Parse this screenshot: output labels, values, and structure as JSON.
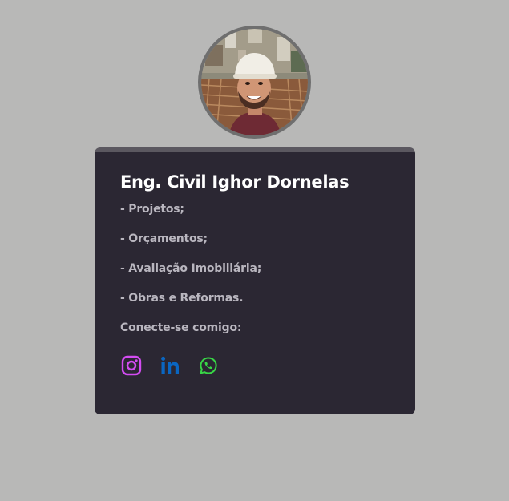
{
  "profile": {
    "name": "Eng. Civil Ighor Dornelas",
    "services": [
      "- Projetos;",
      "- Orçamentos;",
      "- Avaliação Imobiliária;",
      "- Obras e Reformas."
    ],
    "connect_label": "Conecte-se comigo:"
  },
  "socials": [
    {
      "icon": "instagram-icon",
      "color": "#d34cf2"
    },
    {
      "icon": "linkedin-icon",
      "color": "#0a66c2"
    },
    {
      "icon": "whatsapp-icon",
      "color": "#38d646"
    }
  ],
  "colors": {
    "background": "#b8b8b7",
    "card": "#2b2733",
    "card_border": "#5b5860",
    "heading": "#ffffff",
    "text": "#b9b6bf"
  }
}
